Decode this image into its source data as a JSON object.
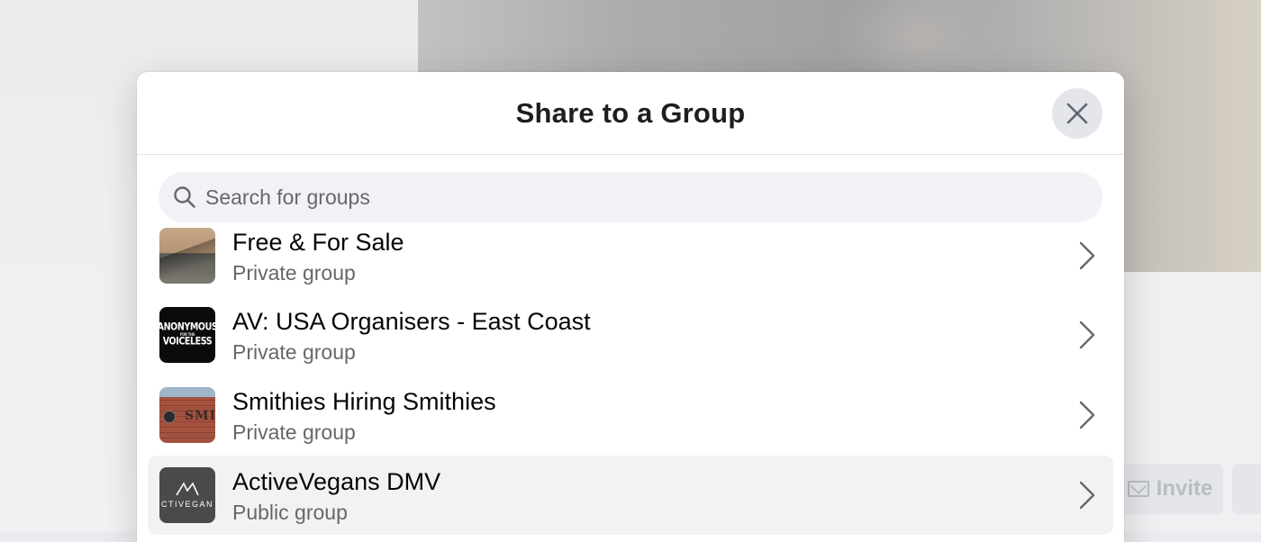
{
  "background": {
    "invite_label": "Invite"
  },
  "modal": {
    "title": "Share to a Group"
  },
  "search": {
    "placeholder": "Search for groups"
  },
  "groups": [
    {
      "name": "Free & For Sale",
      "type": "Private group"
    },
    {
      "name": "AV: USA Organisers - East Coast",
      "type": "Private group",
      "thumb_text_top": "ANONYMOUS",
      "thumb_text_mid": "FOR THE",
      "thumb_text_bottom": "VOICELESS"
    },
    {
      "name": "Smithies Hiring Smithies",
      "type": "Private group",
      "thumb_text": "SMI"
    },
    {
      "name": "ActiveVegans DMV",
      "type": "Public group",
      "thumb_text": "CTIVEGAN"
    }
  ],
  "icons": {
    "close": "close-icon",
    "search": "search-icon",
    "chevron": "chevron-right-icon"
  }
}
